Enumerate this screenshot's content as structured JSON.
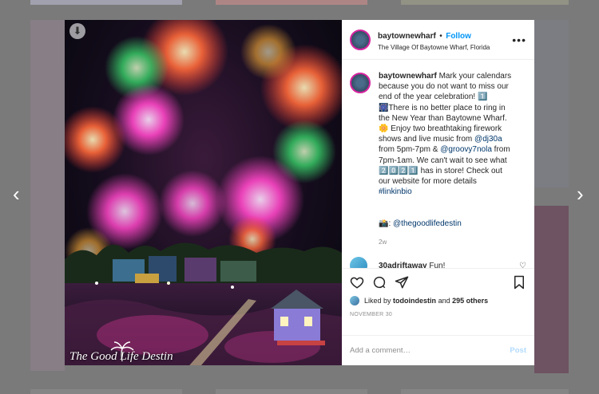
{
  "post": {
    "username": "baytownewharf",
    "separator": "•",
    "follow_label": "Follow",
    "location": "The Village Of Baytowne Wharf, Florida",
    "more_icon": "more-options-icon",
    "caption_lines": [
      "Mark your calendars",
      "because you do not want to miss our",
      "end of the year celebration! 1️⃣",
      "🎆There is no better place to ring in",
      "the New Year than Baytowne Wharf.",
      "🌼 Enjoy two breathtaking firework",
      "shows and live music from "
    ],
    "caption_mention1": "@dj30a",
    "caption_mid": "from 5pm-7pm & ",
    "caption_mention2": "@groovy7nola",
    "caption_mid2": " from",
    "caption_end1": "7pm-1am. We can't wait to see what",
    "caption_year": "2️⃣0️⃣2️⃣1️⃣",
    "caption_end2": " has in store! Check out",
    "caption_end3": "our website for more details",
    "hashtag": "#linkinbio",
    "camera_credit_prefix": "📸: ",
    "camera_credit": "@thegoodlifedestin",
    "caption_time": "2w",
    "watermark": "The Good Life Destin"
  },
  "reply": {
    "username": "30adriftaway",
    "text": "Fun!"
  },
  "actions": {
    "liked_by_prefix": "Liked by ",
    "liked_by_user": "todoindestin",
    "liked_by_suffix": " and ",
    "liked_by_count": "295 others",
    "date": "NOVEMBER 30",
    "comment_placeholder": "Add a comment…",
    "post_label": "Post"
  },
  "nav": {
    "prev_label": "‹",
    "next_label": "›"
  }
}
